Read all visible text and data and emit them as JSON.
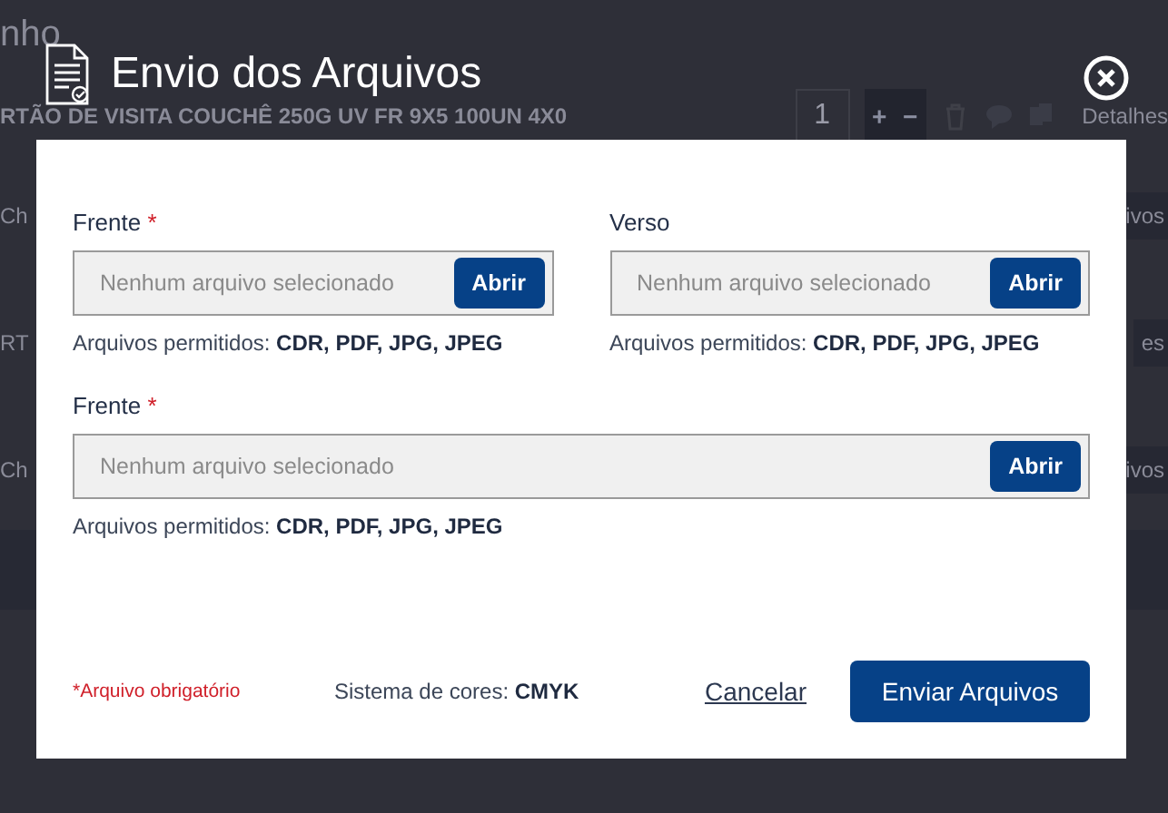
{
  "background": {
    "heading": "nho",
    "product": "RTÃO DE VISITA COUCHÊ 250G UV FR 9X5 100UN 4X0",
    "quantity": "1",
    "increment": "+",
    "decrement": "−",
    "details": "Detalhes",
    "rows": [
      {
        "left": "Ch",
        "right": "ivos"
      },
      {
        "left": "RT",
        "right": "es"
      },
      {
        "left": "Ch",
        "right": "ivos"
      }
    ]
  },
  "dialog": {
    "title": "Envio dos Arquivos",
    "required_mark": "*",
    "uploads": [
      {
        "label": "Frente",
        "required": true,
        "placeholder": "Nenhum arquivo selecionado",
        "button": "Abrir",
        "hint": "Arquivos permitidos: **CDR, PDF, JPG, JPEG**"
      },
      {
        "label": "Verso",
        "required": false,
        "placeholder": "Nenhum arquivo selecionado",
        "button": "Abrir",
        "hint": "Arquivos permitidos: **CDR, PDF, JPG, JPEG**"
      },
      {
        "label": "Frente",
        "required": true,
        "placeholder": "Nenhum arquivo selecionado",
        "button": "Abrir",
        "hint": "Arquivos permitidos: **CDR, PDF, JPG, JPEG**"
      }
    ],
    "required_note": "*Arquivo obrigatório",
    "color_system": "Sistema de cores: **CMYK**",
    "cancel": "Cancelar",
    "submit": "Enviar Arquivos"
  }
}
